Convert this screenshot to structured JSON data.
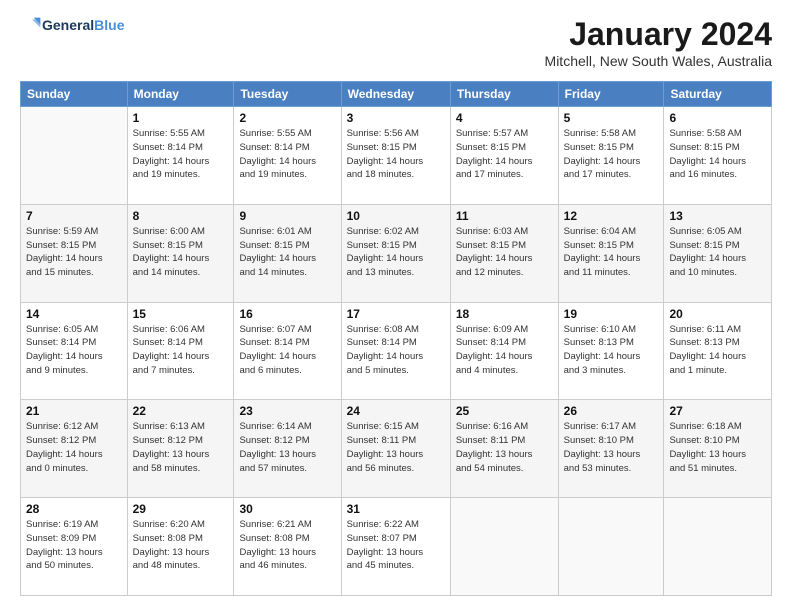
{
  "logo": {
    "text1": "General",
    "text2": "Blue"
  },
  "title": "January 2024",
  "location": "Mitchell, New South Wales, Australia",
  "headers": [
    "Sunday",
    "Monday",
    "Tuesday",
    "Wednesday",
    "Thursday",
    "Friday",
    "Saturday"
  ],
  "weeks": [
    [
      {
        "day": "",
        "info": ""
      },
      {
        "day": "1",
        "info": "Sunrise: 5:55 AM\nSunset: 8:14 PM\nDaylight: 14 hours\nand 19 minutes."
      },
      {
        "day": "2",
        "info": "Sunrise: 5:55 AM\nSunset: 8:14 PM\nDaylight: 14 hours\nand 19 minutes."
      },
      {
        "day": "3",
        "info": "Sunrise: 5:56 AM\nSunset: 8:15 PM\nDaylight: 14 hours\nand 18 minutes."
      },
      {
        "day": "4",
        "info": "Sunrise: 5:57 AM\nSunset: 8:15 PM\nDaylight: 14 hours\nand 17 minutes."
      },
      {
        "day": "5",
        "info": "Sunrise: 5:58 AM\nSunset: 8:15 PM\nDaylight: 14 hours\nand 17 minutes."
      },
      {
        "day": "6",
        "info": "Sunrise: 5:58 AM\nSunset: 8:15 PM\nDaylight: 14 hours\nand 16 minutes."
      }
    ],
    [
      {
        "day": "7",
        "info": "Sunrise: 5:59 AM\nSunset: 8:15 PM\nDaylight: 14 hours\nand 15 minutes."
      },
      {
        "day": "8",
        "info": "Sunrise: 6:00 AM\nSunset: 8:15 PM\nDaylight: 14 hours\nand 14 minutes."
      },
      {
        "day": "9",
        "info": "Sunrise: 6:01 AM\nSunset: 8:15 PM\nDaylight: 14 hours\nand 14 minutes."
      },
      {
        "day": "10",
        "info": "Sunrise: 6:02 AM\nSunset: 8:15 PM\nDaylight: 14 hours\nand 13 minutes."
      },
      {
        "day": "11",
        "info": "Sunrise: 6:03 AM\nSunset: 8:15 PM\nDaylight: 14 hours\nand 12 minutes."
      },
      {
        "day": "12",
        "info": "Sunrise: 6:04 AM\nSunset: 8:15 PM\nDaylight: 14 hours\nand 11 minutes."
      },
      {
        "day": "13",
        "info": "Sunrise: 6:05 AM\nSunset: 8:15 PM\nDaylight: 14 hours\nand 10 minutes."
      }
    ],
    [
      {
        "day": "14",
        "info": "Sunrise: 6:05 AM\nSunset: 8:14 PM\nDaylight: 14 hours\nand 9 minutes."
      },
      {
        "day": "15",
        "info": "Sunrise: 6:06 AM\nSunset: 8:14 PM\nDaylight: 14 hours\nand 7 minutes."
      },
      {
        "day": "16",
        "info": "Sunrise: 6:07 AM\nSunset: 8:14 PM\nDaylight: 14 hours\nand 6 minutes."
      },
      {
        "day": "17",
        "info": "Sunrise: 6:08 AM\nSunset: 8:14 PM\nDaylight: 14 hours\nand 5 minutes."
      },
      {
        "day": "18",
        "info": "Sunrise: 6:09 AM\nSunset: 8:14 PM\nDaylight: 14 hours\nand 4 minutes."
      },
      {
        "day": "19",
        "info": "Sunrise: 6:10 AM\nSunset: 8:13 PM\nDaylight: 14 hours\nand 3 minutes."
      },
      {
        "day": "20",
        "info": "Sunrise: 6:11 AM\nSunset: 8:13 PM\nDaylight: 14 hours\nand 1 minute."
      }
    ],
    [
      {
        "day": "21",
        "info": "Sunrise: 6:12 AM\nSunset: 8:12 PM\nDaylight: 14 hours\nand 0 minutes."
      },
      {
        "day": "22",
        "info": "Sunrise: 6:13 AM\nSunset: 8:12 PM\nDaylight: 13 hours\nand 58 minutes."
      },
      {
        "day": "23",
        "info": "Sunrise: 6:14 AM\nSunset: 8:12 PM\nDaylight: 13 hours\nand 57 minutes."
      },
      {
        "day": "24",
        "info": "Sunrise: 6:15 AM\nSunset: 8:11 PM\nDaylight: 13 hours\nand 56 minutes."
      },
      {
        "day": "25",
        "info": "Sunrise: 6:16 AM\nSunset: 8:11 PM\nDaylight: 13 hours\nand 54 minutes."
      },
      {
        "day": "26",
        "info": "Sunrise: 6:17 AM\nSunset: 8:10 PM\nDaylight: 13 hours\nand 53 minutes."
      },
      {
        "day": "27",
        "info": "Sunrise: 6:18 AM\nSunset: 8:10 PM\nDaylight: 13 hours\nand 51 minutes."
      }
    ],
    [
      {
        "day": "28",
        "info": "Sunrise: 6:19 AM\nSunset: 8:09 PM\nDaylight: 13 hours\nand 50 minutes."
      },
      {
        "day": "29",
        "info": "Sunrise: 6:20 AM\nSunset: 8:08 PM\nDaylight: 13 hours\nand 48 minutes."
      },
      {
        "day": "30",
        "info": "Sunrise: 6:21 AM\nSunset: 8:08 PM\nDaylight: 13 hours\nand 46 minutes."
      },
      {
        "day": "31",
        "info": "Sunrise: 6:22 AM\nSunset: 8:07 PM\nDaylight: 13 hours\nand 45 minutes."
      },
      {
        "day": "",
        "info": ""
      },
      {
        "day": "",
        "info": ""
      },
      {
        "day": "",
        "info": ""
      }
    ]
  ]
}
